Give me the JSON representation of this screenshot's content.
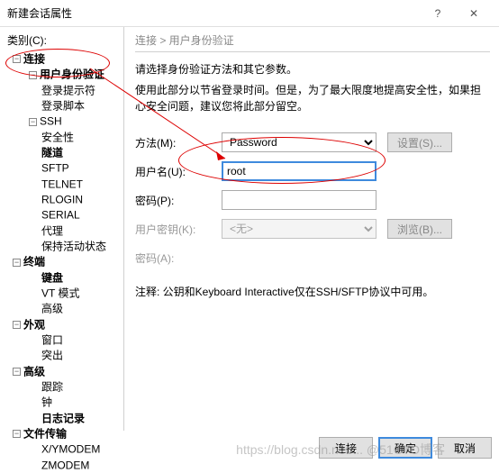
{
  "window": {
    "title": "新建会话属性"
  },
  "leftpanel": {
    "category_label": "类别(C):",
    "tree": {
      "connection": "连接",
      "auth": "用户身份验证",
      "login_prompt": "登录提示符",
      "login_script": "登录脚本",
      "ssh": "SSH",
      "security": "安全性",
      "tunnel": "隧道",
      "sftp": "SFTP",
      "telnet": "TELNET",
      "rlogin": "RLOGIN",
      "serial": "SERIAL",
      "proxy": "代理",
      "keepalive": "保持活动状态",
      "terminal": "终端",
      "keyboard": "键盘",
      "vtmode": "VT 模式",
      "advanced_t": "高级",
      "appearance": "外观",
      "window_a": "窗口",
      "highlight": "突出",
      "advanced": "高级",
      "trace": "跟踪",
      "bell": "钟",
      "logging": "日志记录",
      "filetransfer": "文件传输",
      "xymodem": "X/YMODEM",
      "zmodem": "ZMODEM"
    }
  },
  "rightpanel": {
    "breadcrumb": "连接 > 用户身份验证",
    "desc": "请选择身份验证方法和其它参数。",
    "desc2": "使用此部分以节省登录时间。但是，为了最大限度地提高安全性，如果担心安全问题，建议您将此部分留空。",
    "method_label": "方法(M):",
    "method_value": "Password",
    "settings_btn": "设置(S)...",
    "user_label": "用户名(U):",
    "user_value": "root",
    "pwd_label": "密码(P):",
    "pwd_value": "",
    "userkey_label": "用户密钥(K):",
    "userkey_value": "<无>",
    "browse_btn": "浏览(B)...",
    "passphrase_label": "密码(A):",
    "note": "注释: 公钥和Keyboard Interactive仅在SSH/SFTP协议中可用。"
  },
  "footer": {
    "connect": "连接",
    "ok": "确定",
    "cancel": "取消"
  },
  "watermark": "https://blog.csdn.net/... @51CTO博客"
}
